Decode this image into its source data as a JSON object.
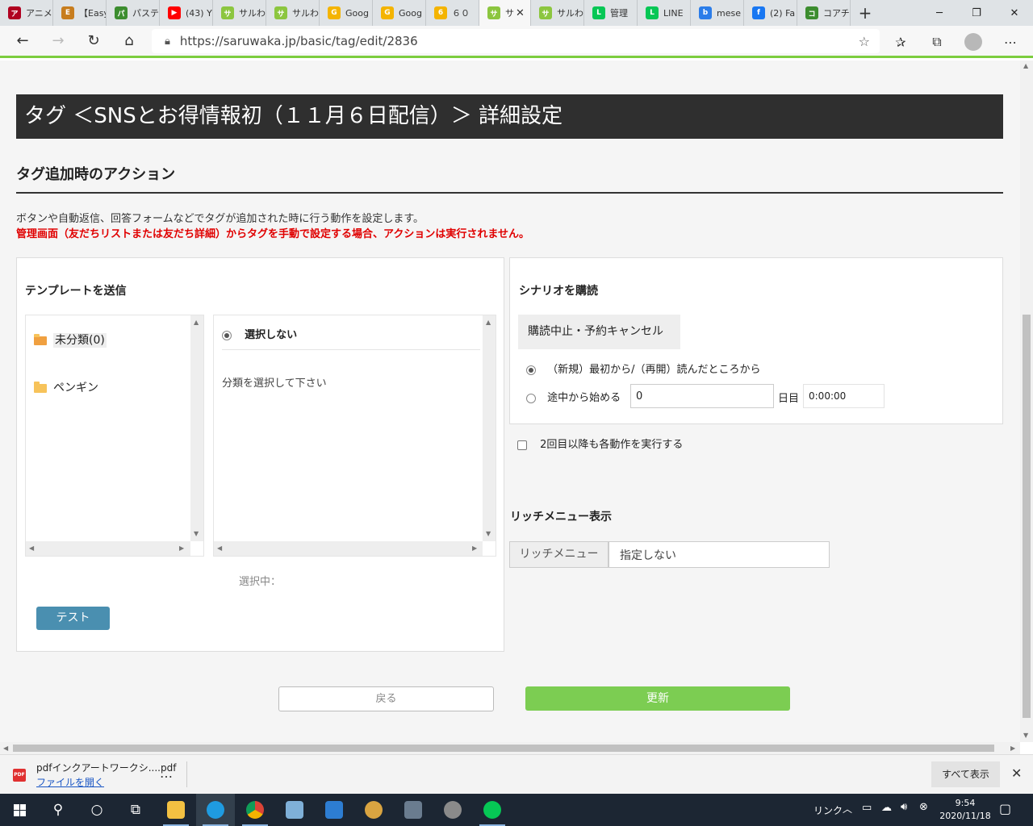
{
  "browser": {
    "tabs": [
      {
        "label": "アニメ",
        "color": "#b00020",
        "glyph": "ア"
      },
      {
        "label": "【Easy",
        "color": "#c77d1e",
        "glyph": "E"
      },
      {
        "label": "パステ",
        "color": "#3c8d2f",
        "glyph": "パ"
      },
      {
        "label": "(43) Y",
        "color": "#ff0000",
        "glyph": "▶"
      },
      {
        "label": "サルわ",
        "color": "#8cc63f",
        "glyph": "サ"
      },
      {
        "label": "サルわ",
        "color": "#8cc63f",
        "glyph": "サ"
      },
      {
        "label": "Goog",
        "color": "#f4b400",
        "glyph": "G"
      },
      {
        "label": "Goog",
        "color": "#f4b400",
        "glyph": "G"
      },
      {
        "label": "６０",
        "color": "#f4b400",
        "glyph": "6"
      },
      {
        "label": "サ",
        "color": "#8cc63f",
        "glyph": "サ",
        "active": true
      },
      {
        "label": "サルわ",
        "color": "#8cc63f",
        "glyph": "サ"
      },
      {
        "label": "管理",
        "color": "#06c755",
        "glyph": "L"
      },
      {
        "label": "LINE",
        "color": "#06c755",
        "glyph": "L"
      },
      {
        "label": "mese",
        "color": "#2b7de9",
        "glyph": "b"
      },
      {
        "label": "(2) Fa",
        "color": "#1877f2",
        "glyph": "f"
      },
      {
        "label": "コアチ",
        "color": "#3c8d2f",
        "glyph": "コ"
      }
    ],
    "new_tab_glyph": "+",
    "url": "https://saruwaka.jp/basic/tag/edit/2836"
  },
  "page": {
    "title": "タグ ＜SNSとお得情報初（１１月６日配信）＞ 詳細設定",
    "section_title": "タグ追加時のアクション",
    "description": "ボタンや自動返信、回答フォームなどでタグが追加された時に行う動作を設定します。",
    "warning": "管理画面（友だちリストまたは友だち詳細）からタグを手動で設定する場合、アクションは実行されません。",
    "template_panel": {
      "title": "テンプレートを送信",
      "folders": [
        "未分類(0)",
        "ペンギン"
      ],
      "none_option": "選択しない",
      "placeholder": "分類を選択して下さい",
      "selected_label": "選択中：",
      "test_button": "テスト"
    },
    "scenario_panel": {
      "title": "シナリオを購読",
      "cancel_tab": "購読中止・予約キャンセル",
      "option_new": "（新規）最初から/（再開）読んだところから",
      "option_mid": "途中から始める",
      "day_value": "0",
      "day_unit": "日目",
      "time_value": "0:00:00"
    },
    "repeat_checkbox": "2回目以降も各動作を実行する",
    "rich_menu": {
      "title": "リッチメニュー表示",
      "label": "リッチメニュー",
      "value": "指定しない"
    },
    "back_button": "戻る",
    "update_button": "更新"
  },
  "download_bar": {
    "filename": "pdfインクアートワークシ....pdf",
    "open_link": "ファイルを開く",
    "more": "…",
    "show_all": "すべて表示"
  },
  "taskbar": {
    "links_label": "リンク",
    "time": "9:54",
    "date": "2020/11/18"
  }
}
